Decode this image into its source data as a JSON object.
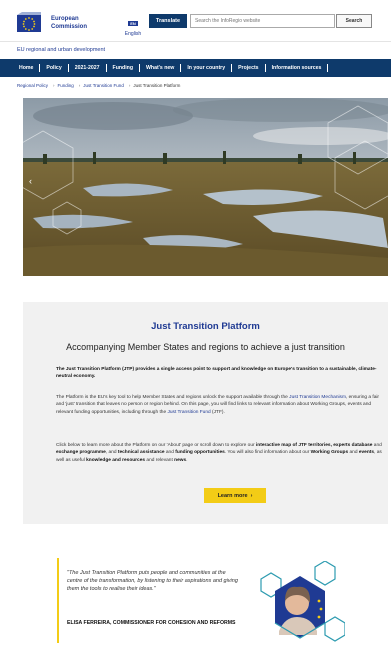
{
  "header": {
    "logo_line1": "European",
    "logo_line2": "Commission",
    "lang_code": "EN",
    "lang_label": "English",
    "translate_label": "Translate",
    "search_placeholder": "Search the InfoRegio website",
    "search_label": "Search"
  },
  "site": {
    "name": "EU regional and urban development"
  },
  "nav": {
    "items": [
      "Home",
      "Policy",
      "2021-2027",
      "Funding",
      "What's new",
      "In your country",
      "Projects",
      "Information sources"
    ]
  },
  "breadcrumb": {
    "items": [
      "Regional Policy",
      "Funding",
      "Just Transition Fund"
    ],
    "current": "Just Transition Platform"
  },
  "info": {
    "title": "Just Transition Platform",
    "subtitle": "Accompanying Member States and regions to achieve a just transition",
    "p1_bold": "The Just Transition Platform (JTP) provides a single access point to support and knowledge on Europe's transition to a sustainable, climate-neutral economy.",
    "p2_a": "The Platform is the EU's key tool to help Member States and regions unlock the support available through the ",
    "p2_link": "Just Transition Mechanism",
    "p2_b": ", ensuring a fair and 'just' transition that leaves no person or region behind. On this page, you will find links to relevant information about Working Groups, events and relevant funding opportunities, including through the ",
    "p2_link2": "Just Transition Fund",
    "p2_c": " (JTF).",
    "p3_a": "Click below to learn more about the Platform on our 'About' page or scroll down to explore our ",
    "p3_b1": "interactive map of JTF territories, experts database",
    "p3_a2": " and ",
    "p3_b2": "exchange programme",
    "p3_a3": ", and ",
    "p3_b3": "technical assistance",
    "p3_a4": " and ",
    "p3_b4": "funding opportunities",
    "p3_a5": ". You will also find information about our ",
    "p3_b5": "Working Groups",
    "p3_a6": " and ",
    "p3_b6": "events",
    "p3_a7": ", as well as useful ",
    "p3_b7": "knowledge and resources",
    "p3_a8": " and relevant ",
    "p3_b8": "news",
    "p3_a9": ".",
    "button_label": "Learn more",
    "button_icon": "›"
  },
  "quote": {
    "text": "\"The Just Transition Platform puts people and communities at the centre of the transformation, by listening to their aspirations and giving them the tools to realise their ideas.\"",
    "author": "ELISA FERREIRA, COMMISSIONER FOR COHESION AND REFORMS"
  },
  "icons": {
    "hero_prev": "chevron-left-icon",
    "button": "chevron-right-icon"
  },
  "colors": {
    "brand_blue": "#0e3a6b",
    "link_blue": "#1f3a93",
    "accent_yellow": "#f3cc16",
    "panel_grey": "#f1f1f1"
  }
}
